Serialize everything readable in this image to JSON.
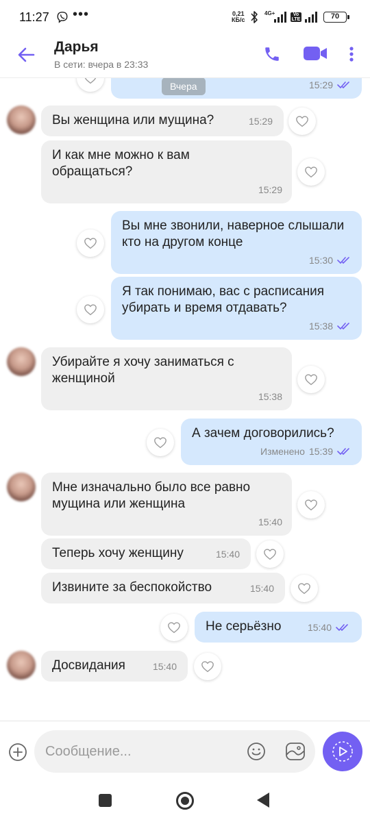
{
  "status_bar": {
    "time": "11:27",
    "more": "•••",
    "net_speed_value": "0,21",
    "net_speed_unit": "КБ/с",
    "battery": "70",
    "volte": "Vo LTE"
  },
  "header": {
    "name": "Дарья",
    "status": "В сети: вчера в 23:33",
    "accent_color": "#7360f2"
  },
  "chat": {
    "date_separator": "Вчера",
    "top_partial": {
      "time": "15:29"
    },
    "messages": [
      {
        "dir": "in",
        "text": "Вы женщина или мущина?",
        "time": "15:29"
      },
      {
        "dir": "in",
        "text": "И как мне можно к вам обращаться?",
        "time": "15:29"
      },
      {
        "dir": "out",
        "text": "Вы мне звонили, наверное слышали кто на другом конце",
        "time": "15:30"
      },
      {
        "dir": "out",
        "text": "Я так понимаю, вас с расписания убирать и время отдавать?",
        "time": "15:38"
      },
      {
        "dir": "in",
        "text": "Убирайте я хочу заниматься с женщиной",
        "time": "15:38"
      },
      {
        "dir": "out",
        "text": "А зачем договорились?",
        "time": "15:39",
        "edited": "Изменено"
      },
      {
        "dir": "in",
        "text": "Мне изначально было все равно мущина или женщина",
        "time": "15:40"
      },
      {
        "dir": "in",
        "text": "Теперь хочу женщину",
        "time": "15:40"
      },
      {
        "dir": "in",
        "text": "Извините за беспокойство",
        "time": "15:40"
      },
      {
        "dir": "out",
        "text": "Не серьёзно",
        "time": "15:40"
      },
      {
        "dir": "in",
        "text": "Досвидания",
        "time": "15:40"
      }
    ]
  },
  "composer": {
    "placeholder": "Сообщение..."
  },
  "icons": [
    "back-arrow-icon",
    "phone-icon",
    "video-camera-icon",
    "kebab-menu-icon",
    "heart-icon",
    "double-check-icon",
    "plus-icon",
    "emoji-icon",
    "sticker-icon",
    "send-icon"
  ]
}
